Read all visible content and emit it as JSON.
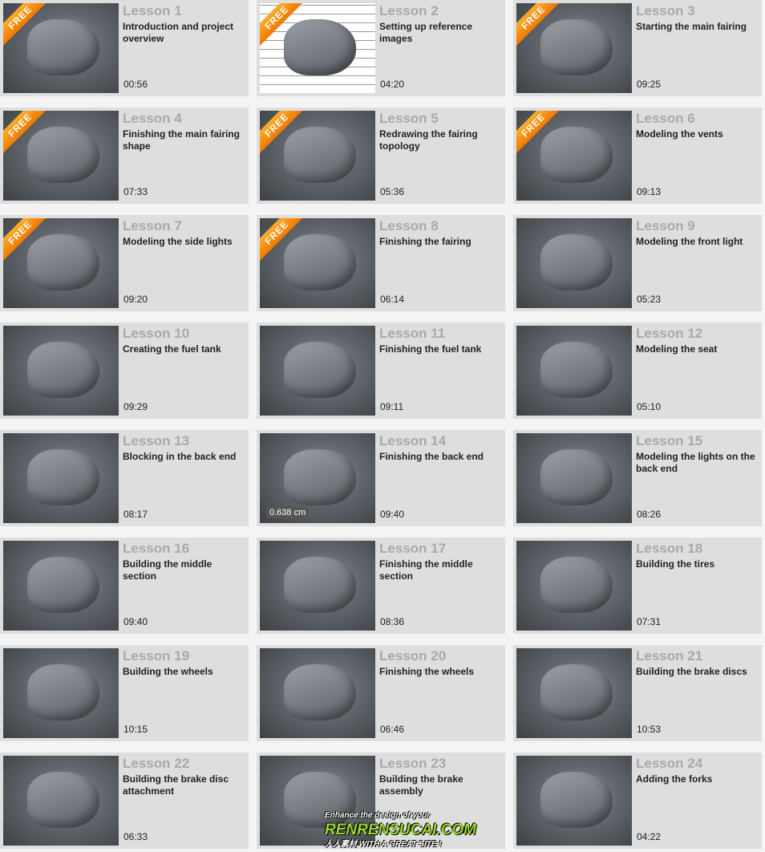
{
  "badge_label": "FREE",
  "lessons": [
    {
      "title": "Lesson 1",
      "desc": "Introduction and project overview",
      "duration": "00:56",
      "free": true
    },
    {
      "title": "Lesson 2",
      "desc": "Setting up reference images",
      "duration": "04:20",
      "free": true,
      "light": true
    },
    {
      "title": "Lesson 3",
      "desc": "Starting the main fairing",
      "duration": "09:25",
      "free": true
    },
    {
      "title": "Lesson 4",
      "desc": "Finishing the main fairing shape",
      "duration": "07:33",
      "free": true
    },
    {
      "title": "Lesson 5",
      "desc": "Redrawing the fairing topology",
      "duration": "05:36",
      "free": true
    },
    {
      "title": "Lesson 6",
      "desc": "Modeling the vents",
      "duration": "09:13",
      "free": true
    },
    {
      "title": "Lesson 7",
      "desc": "Modeling the side lights",
      "duration": "09:20",
      "free": true
    },
    {
      "title": "Lesson 8",
      "desc": "Finishing the fairing",
      "duration": "06:14",
      "free": true
    },
    {
      "title": "Lesson 9",
      "desc": "Modeling the front light",
      "duration": "05:23"
    },
    {
      "title": "Lesson 10",
      "desc": "Creating the fuel tank",
      "duration": "09:29"
    },
    {
      "title": "Lesson 11",
      "desc": "Finishing the fuel tank",
      "duration": "09:11"
    },
    {
      "title": "Lesson 12",
      "desc": "Modeling the seat",
      "duration": "05:10"
    },
    {
      "title": "Lesson 13",
      "desc": "Blocking in the back end",
      "duration": "08:17"
    },
    {
      "title": "Lesson 14",
      "desc": "Finishing the back end",
      "duration": "09:40",
      "thumb_label": "0.638 cm"
    },
    {
      "title": "Lesson 15",
      "desc": "Modeling the lights on the back end",
      "duration": "08:26"
    },
    {
      "title": "Lesson 16",
      "desc": "Building the middle section",
      "duration": "09:40"
    },
    {
      "title": "Lesson 17",
      "desc": "Finishing the middle section",
      "duration": "08:36"
    },
    {
      "title": "Lesson 18",
      "desc": "Building the tires",
      "duration": "07:31"
    },
    {
      "title": "Lesson 19",
      "desc": "Building the wheels",
      "duration": "10:15"
    },
    {
      "title": "Lesson 20",
      "desc": "Finishing the wheels",
      "duration": "06:46"
    },
    {
      "title": "Lesson 21",
      "desc": "Building the brake discs",
      "duration": "10:53"
    },
    {
      "title": "Lesson 22",
      "desc": "Building the brake disc attachment",
      "duration": "06:33"
    },
    {
      "title": "Lesson 23",
      "desc": "Building the brake assembly"
    },
    {
      "title": "Lesson 24",
      "desc": "Adding the forks",
      "duration": "04:22"
    }
  ],
  "watermark": {
    "line1": "Enhance the design of your",
    "line2": "RENRENSUCAI.COM",
    "line3": "人人素材 WITH A GREAT SITE !"
  }
}
